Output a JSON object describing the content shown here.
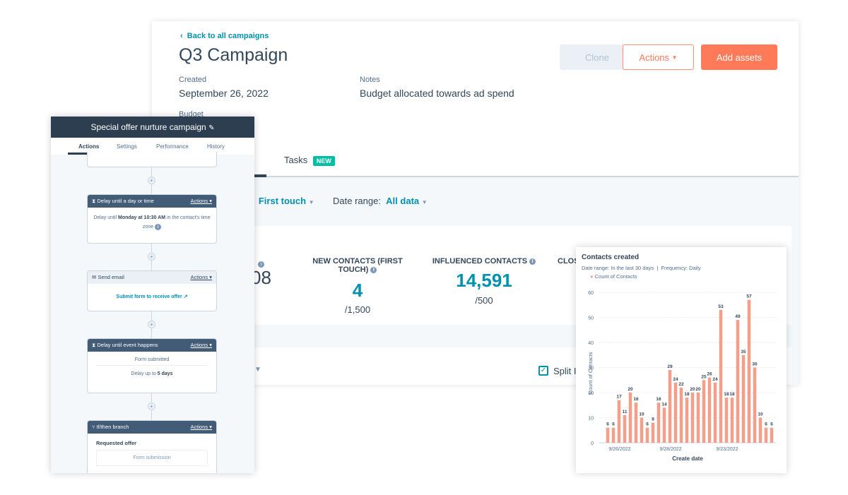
{
  "campaign": {
    "back_link": "Back to all campaigns",
    "title": "Q3 Campaign",
    "clone": "Clone",
    "actions": "Actions",
    "add_assets": "Add assets",
    "created_label": "Created",
    "created_value": "September 26, 2022",
    "notes_label": "Notes",
    "notes_value": "Budget allocated towards ad spend",
    "budget_label": "Budget",
    "tab_tasks": "Tasks",
    "tab_tasks_badge": "NEW",
    "attribution_value": "First touch",
    "date_range_label": "Date range:",
    "date_range_value": "All data",
    "colon": ":",
    "stats": [
      {
        "label": "",
        "value": "08",
        "goal": ")"
      },
      {
        "label": "NEW CONTACTS (FIRST TOUCH)",
        "value": "4",
        "goal": "/1,500"
      },
      {
        "label": "INFLUENCED CONTACTS",
        "value": "14,591",
        "goal": "/500"
      },
      {
        "label": "CLOS",
        "value": "",
        "goal": ""
      }
    ],
    "split_label": "Split I",
    "accent": "#0091ae",
    "orange": "#ff7a59"
  },
  "workflow": {
    "title": "Special offer nurture campaign",
    "tabs": [
      "Actions",
      "Settings",
      "Performance",
      "History"
    ],
    "nodes": [
      {
        "title": "Delay until a day or time",
        "actions": "Actions",
        "pre": "Delay until ",
        "bold": "Monday at 10:30 AM",
        "post": " in the contact's time zone"
      },
      {
        "title": "Send email",
        "actions": "Actions",
        "link": "Submit form to receive offer"
      },
      {
        "title": "Delay until event happens",
        "actions": "Actions",
        "line1": "Form submitted",
        "line2_pre": "Delay up to ",
        "line2_bold": "5 days"
      },
      {
        "title": "If/then branch",
        "actions": "Actions",
        "label": "Requested offer",
        "sub": "Form submission"
      }
    ]
  },
  "chart_data": {
    "type": "bar",
    "title": "Contacts created",
    "subtitle_range": "Date range: In the last 30 days",
    "subtitle_freq": "Frequency: Daily",
    "legend": "Count of Contacts",
    "xlabel": "Create date",
    "ylabel": "Count of Contacts",
    "ylim": [
      0,
      60
    ],
    "yticks": [
      "0",
      "10",
      "20",
      "30",
      "40",
      "50",
      "60"
    ],
    "xticks": [
      {
        "index": 0,
        "label": "9/26/2022"
      },
      {
        "index": 9,
        "label": "9/28/2022"
      },
      {
        "index": 19,
        "label": "9/23/2022"
      }
    ],
    "color": "#f2a08a",
    "values": [
      6,
      6,
      17,
      11,
      20,
      16,
      10,
      6,
      8,
      16,
      14,
      29,
      24,
      22,
      18,
      20,
      20,
      25,
      26,
      24,
      53,
      18,
      18,
      49,
      35,
      57,
      30,
      10,
      6,
      6
    ]
  }
}
